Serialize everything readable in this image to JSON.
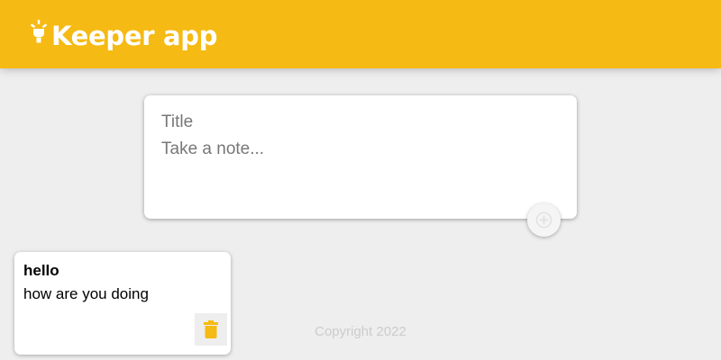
{
  "header": {
    "title": "Keeper app",
    "logo_icon": "lightbulb-icon"
  },
  "create_note": {
    "title_placeholder": "Title",
    "content_placeholder": "Take a note...",
    "add_icon": "plus-icon"
  },
  "notes": [
    {
      "title": "hello",
      "content": "how are you doing",
      "delete_icon": "trash-icon"
    }
  ],
  "footer": {
    "copyright": "Copyright 2022"
  },
  "colors": {
    "accent": "#f5ba13",
    "background": "#eeeeee",
    "card": "#ffffff",
    "footer_text": "#cccccc"
  }
}
